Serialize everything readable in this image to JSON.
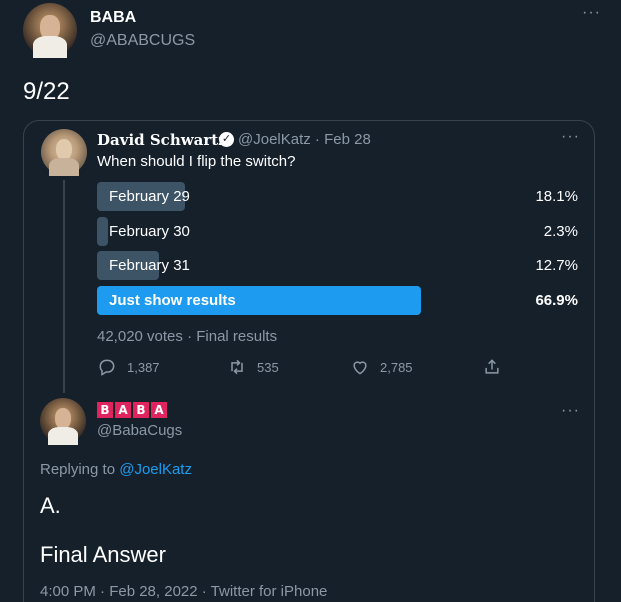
{
  "main_tweet": {
    "author_name": "BABA",
    "author_handle": "@ABABCUGS",
    "text": "9/22",
    "more_icon": "more-horizontal-icon"
  },
  "quoted_tweet": {
    "author_name": "David Schwartz",
    "verified": true,
    "meta": "@JoelKatz · Feb 28",
    "text": "When should I flip the switch?",
    "poll": {
      "options": [
        {
          "label": "February 29",
          "percent_text": "18.1%",
          "percent": 18.1,
          "winner": false
        },
        {
          "label": "February 30",
          "percent_text": "2.3%",
          "percent": 2.3,
          "winner": false
        },
        {
          "label": "February 31",
          "percent_text": "12.7%",
          "percent": 12.7,
          "winner": false
        },
        {
          "label": "Just show results",
          "percent_text": "66.9%",
          "percent": 66.9,
          "winner": true
        }
      ],
      "footer": "42,020 votes · Final results"
    },
    "actions": {
      "replies": "1,387",
      "retweets": "535",
      "likes": "2,785"
    }
  },
  "reply_tweet": {
    "author_tiles": [
      "B",
      "A",
      "B",
      "A"
    ],
    "author_handle": "@BabaCugs",
    "replying_prefix": "Replying to ",
    "replying_to": "@JoelKatz",
    "line1": "A.",
    "line2": "Final Answer",
    "timestamp": "4:00 PM · Feb 28, 2022 · Twitter for iPhone"
  },
  "colors": {
    "background": "#15202b",
    "accent": "#1d9bf0",
    "poll_bar": "#3d5466",
    "muted": "#8b98a5",
    "tile": "#e0245e"
  }
}
